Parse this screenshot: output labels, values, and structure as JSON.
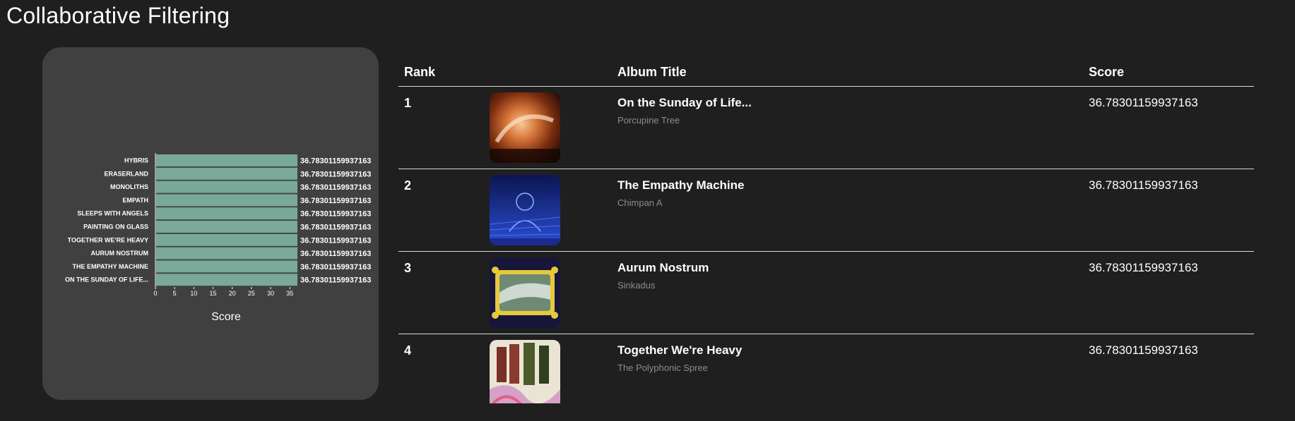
{
  "page": {
    "title": "Collaborative Filtering"
  },
  "colors": {
    "background": "#1f1f1f",
    "card": "#404040",
    "bar": "#7aa899",
    "muted": "#8c8c8c"
  },
  "chart_data": {
    "type": "bar",
    "orientation": "horizontal",
    "title": "",
    "xlabel": "Score",
    "ylabel": "",
    "categories": [
      "HYBRIS",
      "ERASERLAND",
      "MONOLITHS",
      "EMPATH",
      "SLEEPS WITH ANGELS",
      "PAINTING ON GLASS",
      "TOGETHER WE'RE HEAVY",
      "AURUM NOSTRUM",
      "THE EMPATHY MACHINE",
      "ON THE SUNDAY OF LIFE..."
    ],
    "values": [
      36.78301159937163,
      36.78301159937163,
      36.78301159937163,
      36.78301159937163,
      36.78301159937163,
      36.78301159937163,
      36.78301159937163,
      36.78301159937163,
      36.78301159937163,
      36.78301159937163
    ],
    "value_labels": [
      "36.78301159937163",
      "36.78301159937163",
      "36.78301159937163",
      "36.78301159937163",
      "36.78301159937163",
      "36.78301159937163",
      "36.78301159937163",
      "36.78301159937163",
      "36.78301159937163",
      "36.78301159937163"
    ],
    "xticks": [
      "0",
      "5",
      "10",
      "15",
      "20",
      "25",
      "30",
      "35"
    ],
    "xlim": [
      0,
      36.78301159937163
    ],
    "grid": false
  },
  "table": {
    "headers": {
      "rank": "Rank",
      "album": "Album Title",
      "score": "Score"
    },
    "rows": [
      {
        "rank": "1",
        "title": "On the Sunday of Life...",
        "artist": "Porcupine Tree",
        "score": "36.78301159937163",
        "cover_icon": "album-cover-orange-abstract"
      },
      {
        "rank": "2",
        "title": "The Empathy Machine",
        "artist": "Chimpan A",
        "score": "36.78301159937163",
        "cover_icon": "album-cover-blue-figure"
      },
      {
        "rank": "3",
        "title": "Aurum Nostrum",
        "artist": "Sinkadus",
        "score": "36.78301159937163",
        "cover_icon": "album-cover-gold-frame"
      },
      {
        "rank": "4",
        "title": "Together We're Heavy",
        "artist": "The Polyphonic Spree",
        "score": "36.78301159937163",
        "cover_icon": "album-cover-robed-figures"
      }
    ]
  }
}
